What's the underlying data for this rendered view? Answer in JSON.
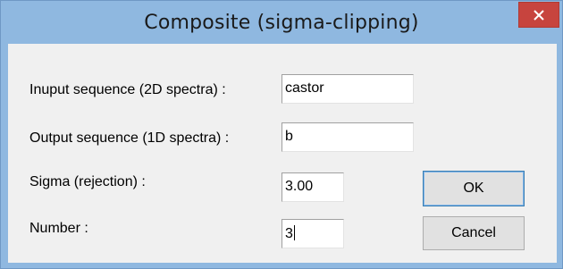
{
  "window": {
    "title": "Composite (sigma-clipping)",
    "close_icon": "close-icon",
    "accent_color": "#8fb8e0",
    "close_color": "#c7443e"
  },
  "form": {
    "input_sequence": {
      "label": "Inuput sequence (2D spectra) :",
      "value": "castor"
    },
    "output_sequence": {
      "label": "Output sequence (1D spectra) :",
      "value": "b"
    },
    "sigma": {
      "label": "Sigma (rejection) :",
      "value": "3.00"
    },
    "number": {
      "label": "Number :",
      "value": "3"
    }
  },
  "buttons": {
    "ok_label": "OK",
    "cancel_label": "Cancel"
  }
}
